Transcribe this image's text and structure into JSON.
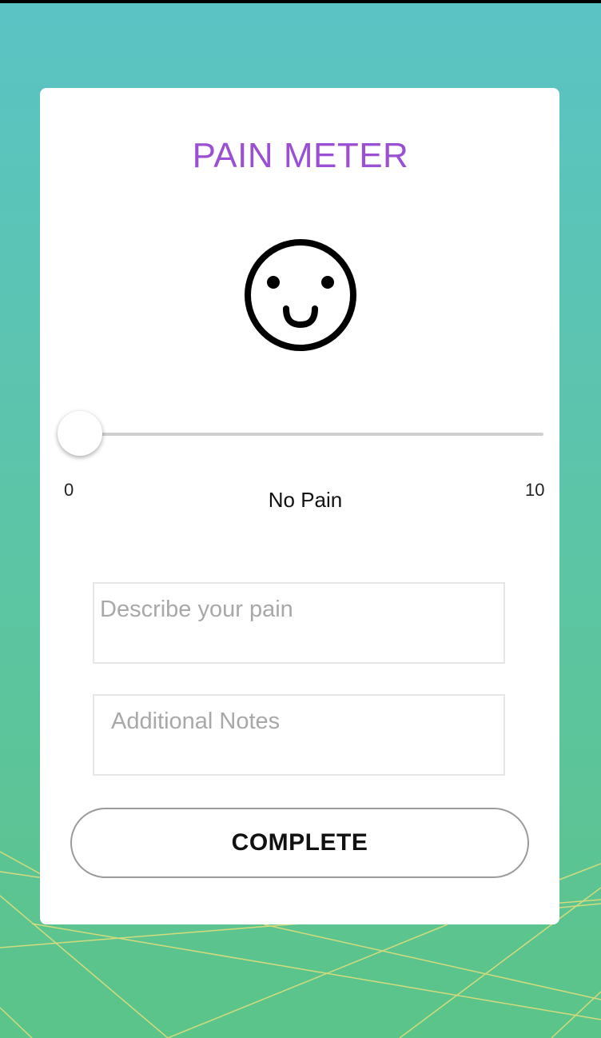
{
  "header": {
    "title": "PAIN METER"
  },
  "meter": {
    "face_icon": "smiley-face-icon",
    "min_label": "0",
    "max_label": "10",
    "value": 0,
    "level_label": "No Pain"
  },
  "form": {
    "describe_placeholder": "Describe your pain",
    "notes_placeholder": "Additional Notes",
    "complete_label": "COMPLETE"
  },
  "colors": {
    "title": "#9b4fd2",
    "background_top": "#5bc3c4",
    "background_bottom": "#5bc489",
    "line_accent": "#e8e07a"
  }
}
